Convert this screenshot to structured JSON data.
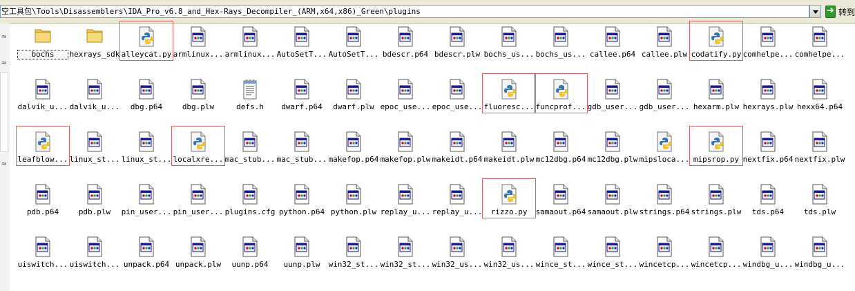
{
  "address": {
    "path": "空工具包\\Tools\\Disassemblers\\IDA_Pro_v6.8_and_Hex-Rays_Decompiler_(ARM,x64,x86)_Green\\plugins",
    "go_label": "转到"
  },
  "left_pane": {
    "tab_glyphs": [
      "≈",
      "≈",
      "≈"
    ]
  },
  "files": [
    {
      "name": "bochs",
      "type": "folder"
    },
    {
      "name": "hexrays_sdk",
      "type": "folder"
    },
    {
      "name": "alleycat.py",
      "type": "python",
      "highlight": true
    },
    {
      "name": "armlinux...",
      "type": "plugin"
    },
    {
      "name": "armlinux...",
      "type": "plugin"
    },
    {
      "name": "AutoSetT...",
      "type": "plugin"
    },
    {
      "name": "AutoSetT...",
      "type": "plugin"
    },
    {
      "name": "bdescr.p64",
      "type": "plugin"
    },
    {
      "name": "bdescr.plw",
      "type": "plugin"
    },
    {
      "name": "bochs_us...",
      "type": "plugin"
    },
    {
      "name": "bochs_us...",
      "type": "plugin"
    },
    {
      "name": "callee.p64",
      "type": "plugin"
    },
    {
      "name": "callee.plw",
      "type": "plugin"
    },
    {
      "name": "codatify.py",
      "type": "python",
      "highlight": true
    },
    {
      "name": "comhelpe...",
      "type": "plugin"
    },
    {
      "name": "comhelpe...",
      "type": "plugin"
    },
    {
      "name": "dalvik_u...",
      "type": "plugin"
    },
    {
      "name": "dalvik_u...",
      "type": "plugin"
    },
    {
      "name": "dbg.p64",
      "type": "plugin"
    },
    {
      "name": "dbg.plw",
      "type": "plugin"
    },
    {
      "name": "defs.h",
      "type": "text"
    },
    {
      "name": "dwarf.p64",
      "type": "plugin"
    },
    {
      "name": "dwarf.plw",
      "type": "plugin"
    },
    {
      "name": "epoc_use...",
      "type": "plugin"
    },
    {
      "name": "epoc_use...",
      "type": "plugin"
    },
    {
      "name": "fluoresc...",
      "type": "python",
      "highlight": true
    },
    {
      "name": "funcprof...",
      "type": "python",
      "highlight": true
    },
    {
      "name": "gdb_user...",
      "type": "plugin"
    },
    {
      "name": "gdb_user...",
      "type": "plugin"
    },
    {
      "name": "hexarm.plw",
      "type": "plugin"
    },
    {
      "name": "hexrays.plw",
      "type": "plugin"
    },
    {
      "name": "hexx64.p64",
      "type": "plugin"
    },
    {
      "name": "leafblow...",
      "type": "python",
      "highlight": true
    },
    {
      "name": "linux_st...",
      "type": "plugin"
    },
    {
      "name": "linux_st...",
      "type": "plugin"
    },
    {
      "name": "localxre...",
      "type": "python",
      "highlight": true
    },
    {
      "name": "mac_stub...",
      "type": "plugin"
    },
    {
      "name": "mac_stub...",
      "type": "plugin"
    },
    {
      "name": "makefop.p64",
      "type": "plugin"
    },
    {
      "name": "makefop.plw",
      "type": "plugin"
    },
    {
      "name": "makeidt.p64",
      "type": "plugin"
    },
    {
      "name": "makeidt.plw",
      "type": "plugin"
    },
    {
      "name": "mc12dbg.p64",
      "type": "plugin"
    },
    {
      "name": "mc12dbg.plw",
      "type": "plugin"
    },
    {
      "name": "mipsloca...",
      "type": "python"
    },
    {
      "name": "mipsrop.py",
      "type": "python",
      "highlight": true
    },
    {
      "name": "nextfix.p64",
      "type": "plugin"
    },
    {
      "name": "nextfix.plw",
      "type": "plugin"
    },
    {
      "name": "pdb.p64",
      "type": "plugin"
    },
    {
      "name": "pdb.plw",
      "type": "plugin"
    },
    {
      "name": "pin_user...",
      "type": "plugin"
    },
    {
      "name": "pin_user...",
      "type": "plugin"
    },
    {
      "name": "plugins.cfg",
      "type": "plugin"
    },
    {
      "name": "python.p64",
      "type": "plugin"
    },
    {
      "name": "python.plw",
      "type": "plugin"
    },
    {
      "name": "replay_u...",
      "type": "plugin"
    },
    {
      "name": "replay_u...",
      "type": "plugin"
    },
    {
      "name": "rizzo.py",
      "type": "python",
      "highlight": true
    },
    {
      "name": "samaout.p64",
      "type": "plugin"
    },
    {
      "name": "samaout.plw",
      "type": "plugin"
    },
    {
      "name": "strings.p64",
      "type": "plugin"
    },
    {
      "name": "strings.plw",
      "type": "plugin"
    },
    {
      "name": "tds.p64",
      "type": "plugin"
    },
    {
      "name": "tds.plw",
      "type": "plugin"
    },
    {
      "name": "uiswitch...",
      "type": "plugin"
    },
    {
      "name": "uiswitch...",
      "type": "plugin"
    },
    {
      "name": "unpack.p64",
      "type": "plugin"
    },
    {
      "name": "unpack.plw",
      "type": "plugin"
    },
    {
      "name": "uunp.p64",
      "type": "plugin"
    },
    {
      "name": "uunp.plw",
      "type": "plugin"
    },
    {
      "name": "win32_st...",
      "type": "plugin"
    },
    {
      "name": "win32_st...",
      "type": "plugin"
    },
    {
      "name": "win32_us...",
      "type": "plugin"
    },
    {
      "name": "win32_us...",
      "type": "plugin"
    },
    {
      "name": "wince_st...",
      "type": "plugin"
    },
    {
      "name": "wince_st...",
      "type": "plugin"
    },
    {
      "name": "wincetcp...",
      "type": "plugin"
    },
    {
      "name": "wincetcp...",
      "type": "plugin"
    },
    {
      "name": "windbg_u...",
      "type": "plugin"
    },
    {
      "name": "windbg_u...",
      "type": "plugin"
    }
  ],
  "colors": {
    "highlight_box": "#e06060",
    "folder": "#f2c94c",
    "python_blue": "#3a75b0",
    "python_yellow": "#f2c230"
  }
}
